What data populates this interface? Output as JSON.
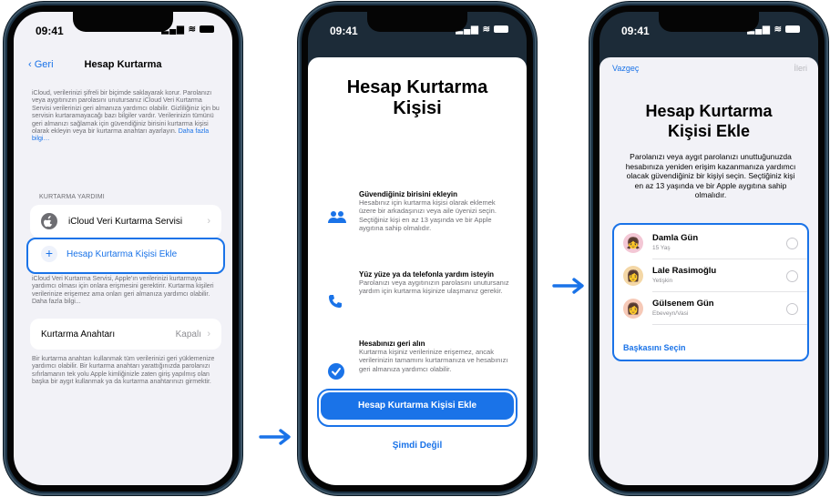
{
  "screen1": {
    "time": "09:41",
    "back_label": "Geri",
    "title": "Hesap Kurtarma",
    "intro": "iCloud, verilerinizi şifreli bir biçimde saklayarak korur. Parolanızı veya aygıtınızın parolasını unutursanız iCloud Veri Kurtarma Servisi verilerinizi geri almanıza yardımcı olabilir. Gizliliğiniz için bu servisin kurtaramayacağı bazı bilgiler vardır. Verilerinizin tümünü geri almanızı sağlamak için güvendiğiniz birisini kurtarma kişisi olarak ekleyin veya bir kurtarma anahtarı ayarlayın.",
    "intro_link": "Daha fazla bilgi…",
    "section_header": "KURTARMA YARDIMI",
    "icloud_service": "iCloud Veri Kurtarma Servisi",
    "add_contact": "Hesap Kurtarma Kişisi Ekle",
    "note1": "iCloud Veri Kurtarma Servisi, Apple'ın verilerinizi kurtarmaya yardımcı olması için onlara erişmesini gerektirir. Kurtarma kişileri verilerinize erişemez ama onları geri almanıza yardımcı olabilir. Daha fazla bilgi...",
    "recovery_key_label": "Kurtarma Anahtarı",
    "recovery_key_value": "Kapalı",
    "note2": "Bir kurtarma anahtarı kullanmak tüm verilerinizi geri yüklemenize yardımcı olabilir. Bir kurtarma anahtarı yarattığınızda parolanızı sıfırlamanın tek yolu Apple kimliğinizle zaten giriş yapılmış olan başka bir aygıt kullanmak ya da kurtarma anahtarınızı girmektir."
  },
  "screen2": {
    "time": "09:41",
    "title": "Hesap Kurtarma Kişisi",
    "features": [
      {
        "title": "Güvendiğiniz birisini ekleyin",
        "body": "Hesabınız için kurtarma kişisi olarak eklemek üzere bir arkadaşınızı veya aile üyenizi seçin. Seçtiğiniz kişi en az 13 yaşında ve bir Apple aygıtına sahip olmalıdır.",
        "icon": "people-icon"
      },
      {
        "title": "Yüz yüze ya da telefonla yardım isteyin",
        "body": "Parolanızı veya aygıtınızın parolasını unutursanız yardım için kurtarma kişinize ulaşmanız gerekir.",
        "icon": "phone-icon"
      },
      {
        "title": "Hesabınızı geri alın",
        "body": "Kurtarma kişiniz verilerinize erişemez, ancak verilerinizin tamamını kurtarmanıza ve hesabınızı geri almanıza yardımcı olabilir.",
        "icon": "checkmark-icon"
      }
    ],
    "primary_button": "Hesap Kurtarma Kişisi Ekle",
    "secondary_button": "Şimdi Değil"
  },
  "screen3": {
    "time": "09:41",
    "cancel_label": "Vazgeç",
    "next_label": "İleri",
    "title": "Hesap Kurtarma Kişisi Ekle",
    "description": "Parolanızı veya aygıt parolanızı unuttuğunuzda hesabınıza yeniden erişim kazanmanıza yardımcı olacak güvendiğiniz bir kişiyi seçin. Seçtiğiniz kişi en az 13 yaşında ve bir Apple aygıtına sahip olmalıdır.",
    "contacts": [
      {
        "name": "Damla Gün",
        "detail": "15 Yaş"
      },
      {
        "name": "Lale Rasimoğlu",
        "detail": "Yetişkin"
      },
      {
        "name": "Gülsenem Gün",
        "detail": "Ebeveyn/Vasi"
      }
    ],
    "choose_other": "Başkasını Seçin"
  },
  "colors": {
    "accent": "#1a73e8",
    "frame": "#1b3143"
  }
}
